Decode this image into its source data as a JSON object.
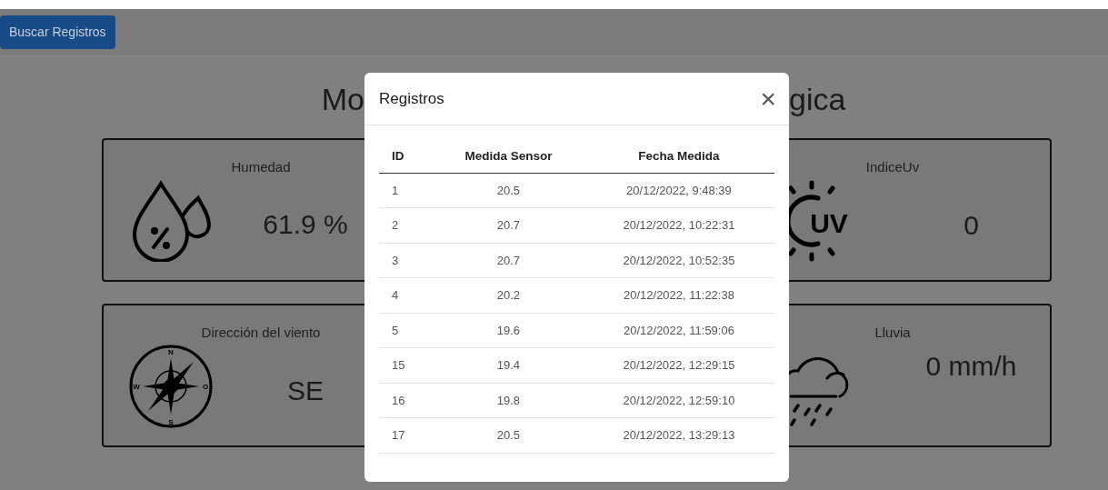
{
  "header": {
    "button": "Buscar Registros"
  },
  "title_visible_parts": [
    "Mo",
    "gica"
  ],
  "cards": [
    {
      "kind": "humidity",
      "label": "Humedad",
      "value": "61.9 %"
    },
    {
      "kind": "uv",
      "label": "IndiceUv",
      "value": "0",
      "icon_text": "UV"
    },
    {
      "kind": "wind",
      "label": "Dirección del viento",
      "value": "SE",
      "icon_text": [
        "N",
        "W",
        "O",
        "S"
      ]
    },
    {
      "kind": "rain",
      "label": "Lluvia",
      "value": "0 mm/h"
    }
  ],
  "modal": {
    "title": "Registros",
    "close": "×",
    "table": {
      "columns": [
        "ID",
        "Medida Sensor",
        "Fecha Medida"
      ],
      "rows": [
        [
          "1",
          "20.5",
          "20/12/2022, 9:48:39"
        ],
        [
          "2",
          "20.7",
          "20/12/2022, 10:22:31"
        ],
        [
          "3",
          "20.7",
          "20/12/2022, 10:52:35"
        ],
        [
          "4",
          "20.2",
          "20/12/2022, 11:22:38"
        ],
        [
          "5",
          "19.6",
          "20/12/2022, 11:59:06"
        ],
        [
          "15",
          "19.4",
          "20/12/2022, 12:29:15"
        ],
        [
          "16",
          "19.8",
          "20/12/2022, 12:59:10"
        ],
        [
          "17",
          "20.5",
          "20/12/2022, 13:29:13"
        ]
      ]
    }
  }
}
